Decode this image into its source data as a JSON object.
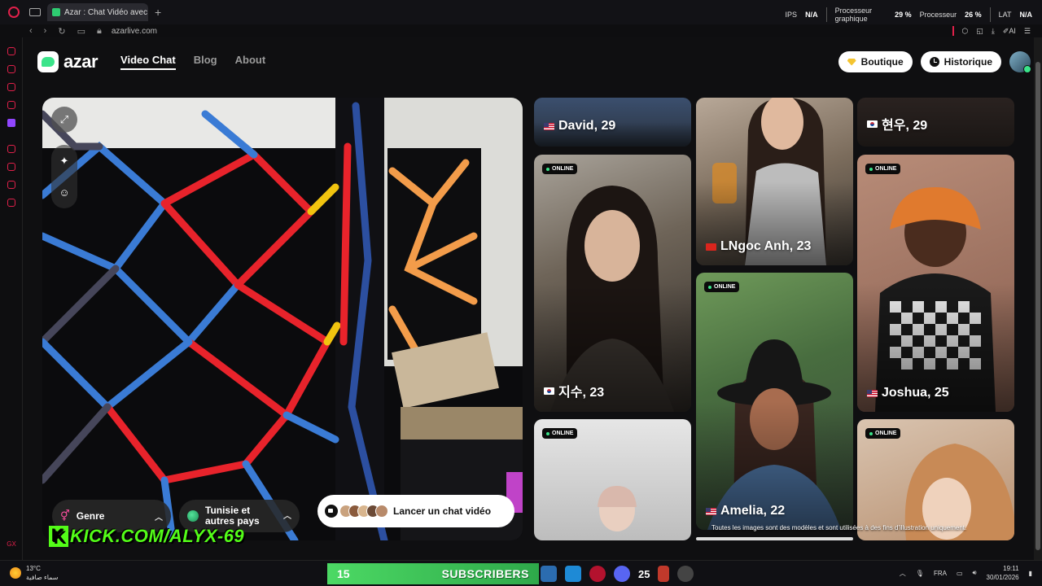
{
  "browser": {
    "tab_title": "Azar : Chat Vidéo avec de",
    "url": "azarlive.com",
    "stats": {
      "ips_label": "IPS",
      "ips_value": "N/A",
      "gpu_label_1": "Processeur",
      "gpu_label_2": "graphique",
      "gpu_value": "29 %",
      "cpu_label": "Processeur",
      "cpu_value": "26 %",
      "lat_label": "LAT",
      "lat_value": "N/A"
    },
    "ai_label": "AI"
  },
  "sidebar_bottom": "GX",
  "header": {
    "logo": "azar",
    "nav": [
      {
        "label": "Video Chat",
        "active": true
      },
      {
        "label": "Blog",
        "active": false
      },
      {
        "label": "About",
        "active": false
      }
    ],
    "boutique": "Boutique",
    "historique": "Historique"
  },
  "video": {
    "genre_label": "Genre",
    "country_label_1": "Tunisie et",
    "country_label_2": "autres pays",
    "start_chat": "Lancer un chat vidéo",
    "overlay_text": "KICK.COM/ALYX-69"
  },
  "profiles": {
    "online_badge": "ONLINE",
    "col1": [
      {
        "name": "David, 29",
        "flag": "us",
        "online": false
      },
      {
        "name": "지수, 23",
        "flag": "kr",
        "online": true
      },
      {
        "name": "",
        "flag": "",
        "online": true
      }
    ],
    "col2": [
      {
        "name": "LNgoc Anh, 23",
        "flag": "vn",
        "online": false
      },
      {
        "name": "Amelia, 22",
        "flag": "us",
        "online": true
      }
    ],
    "col3": [
      {
        "name": "현우, 29",
        "flag": "kr",
        "online": false
      },
      {
        "name": "Joshua, 25",
        "flag": "us",
        "online": true
      },
      {
        "name": "",
        "flag": "",
        "online": true
      }
    ],
    "disclaimer": "Toutes les images sont des modèles et sont utilisées à des fins d'illustration uniquement."
  },
  "taskbar": {
    "temperature": "13°C",
    "weather_desc": "سماء صافية",
    "sub_count": "15",
    "sub_label": "SUBSCRIBERS",
    "badge_count": "25",
    "lang": "FRA",
    "time": "19:11",
    "date": "30/01/2026"
  },
  "colors": {
    "accent_green": "#3be48a",
    "opera_red": "#e0204a",
    "kick_green": "#53fc18"
  }
}
